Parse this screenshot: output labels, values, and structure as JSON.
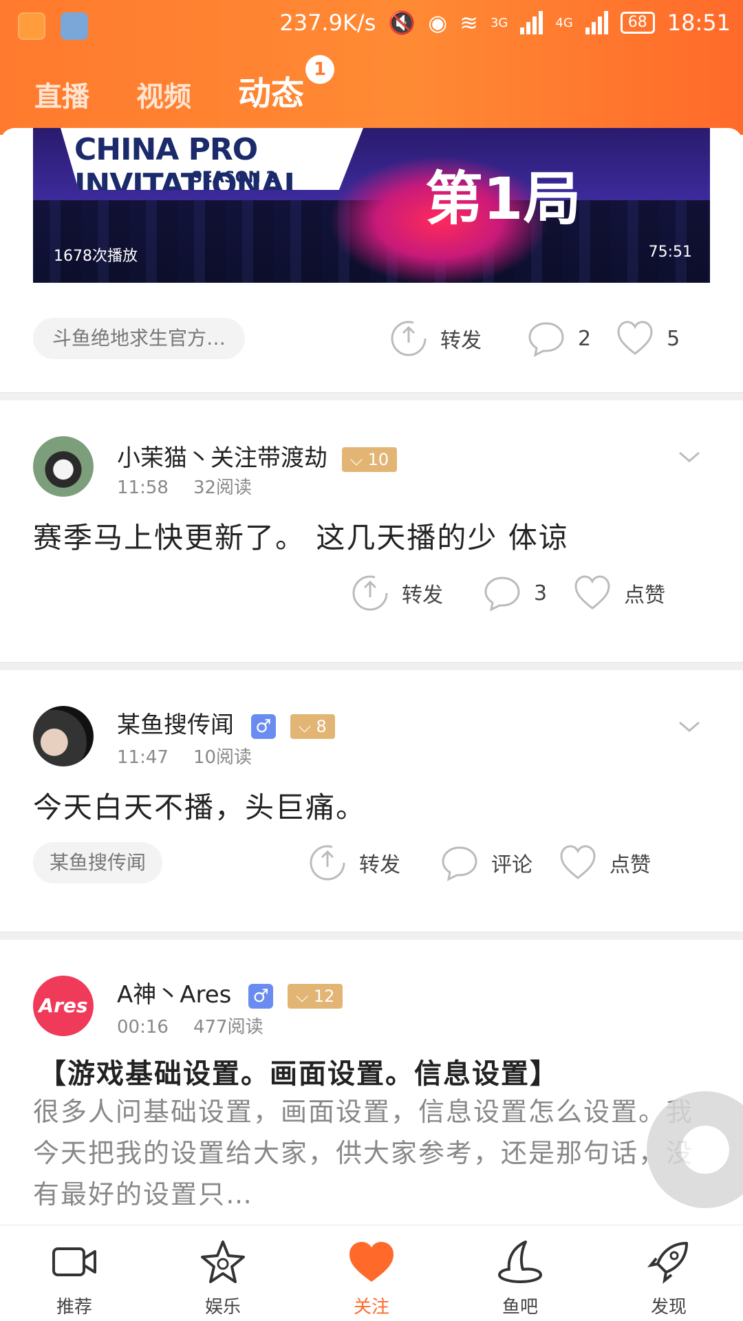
{
  "status_bar": {
    "speed": "237.9K/s",
    "net1": "3G",
    "net2": "4G",
    "battery": "68",
    "time": "18:51"
  },
  "top_tabs": [
    {
      "label": "直播"
    },
    {
      "label": "视频"
    },
    {
      "label": "动态",
      "badge": "1"
    }
  ],
  "video_card": {
    "logo_line1": "CHINA PRO INVITATIONAL",
    "logo_line2": "SEASON 2",
    "overlay_title": "第1局",
    "plays": "1678次播放",
    "duration": "75:51",
    "source": "斗鱼绝地求生官方…",
    "repost": "转发",
    "comments": "2",
    "likes": "5"
  },
  "posts": [
    {
      "name": "小茉猫丶关注带渡劫",
      "level": "10",
      "time": "11:58",
      "reads": "32阅读",
      "text": "赛季马上快更新了。 这几天播的少  体谅",
      "repost": "转发",
      "comments": "3",
      "like": "点赞"
    },
    {
      "name": "某鱼搜传闻",
      "sex": "♂",
      "level": "8",
      "time": "11:47",
      "reads": "10阅读",
      "text": "今天白天不播，头巨痛。",
      "tag": "某鱼搜传闻",
      "repost": "转发",
      "comment": "评论",
      "like": "点赞"
    },
    {
      "name": "A神丶Ares",
      "sex": "♂",
      "level": "12",
      "time": "00:16",
      "reads": "477阅读",
      "avatar_text": "Ares",
      "title": "【游戏基础设置。画面设置。信息设置】",
      "excerpt": "很多人问基础设置，画面设置，信息设置怎么设置。我今天把我的设置给大家，供大家参考，还是那句话，没有最好的设置只…"
    }
  ],
  "bottom_nav": [
    {
      "label": "推荐",
      "icon": "video-camera-icon"
    },
    {
      "label": "娱乐",
      "icon": "star-icon"
    },
    {
      "label": "关注",
      "icon": "heart-icon"
    },
    {
      "label": "鱼吧",
      "icon": "fish-fin-icon"
    },
    {
      "label": "发现",
      "icon": "rocket-icon"
    }
  ],
  "colors": {
    "accent": "#ff7a2e",
    "level_badge": "#e2b574",
    "male_badge": "#6a8cf0"
  }
}
